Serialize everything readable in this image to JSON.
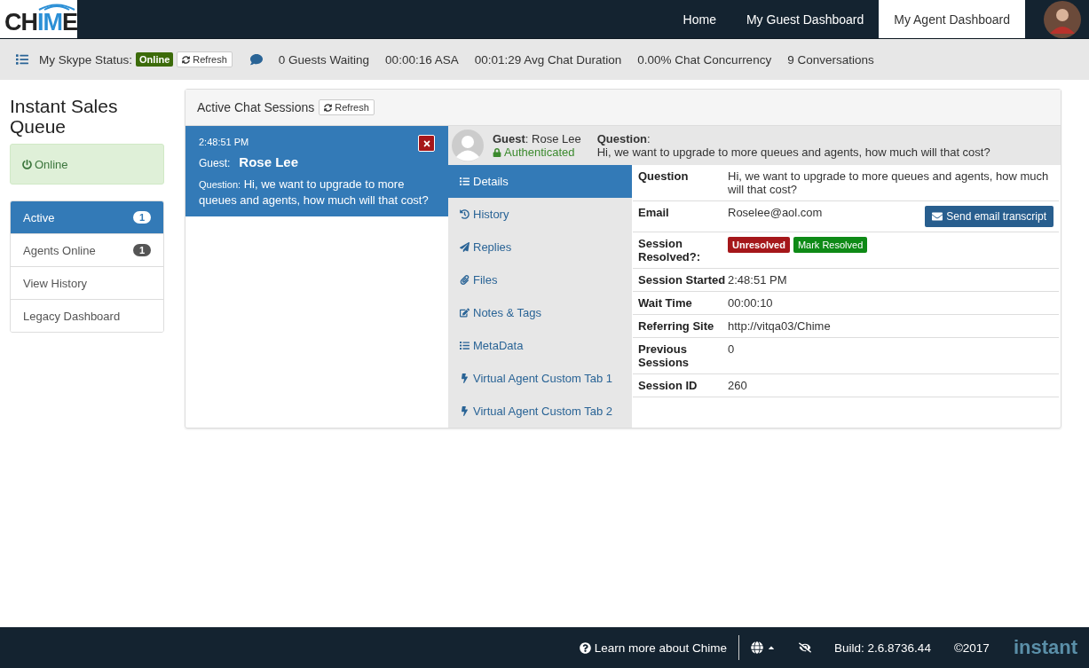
{
  "logo": {
    "parts": [
      {
        "text": "CH",
        "highlight": false
      },
      {
        "text": "IM",
        "highlight": true
      },
      {
        "text": "E",
        "highlight": false
      }
    ]
  },
  "nav": [
    {
      "label": "Home",
      "selected": false
    },
    {
      "label": "My Guest Dashboard",
      "selected": false
    },
    {
      "label": "My Agent Dashboard",
      "selected": true
    }
  ],
  "toolbar": {
    "skype_label": "My Skype Status:",
    "skype_status": "Online",
    "refresh": "Refresh",
    "stats": [
      "0 Guests Waiting",
      "00:00:16 ASA",
      "00:01:29 Avg Chat Duration",
      "0.00% Chat Concurrency",
      "9 Conversations"
    ]
  },
  "sidebar": {
    "title": "Instant Sales Queue",
    "status": "Online",
    "items": [
      {
        "label": "Active",
        "badge": "1",
        "selected": true
      },
      {
        "label": "Agents Online",
        "badge": "1",
        "selected": false
      },
      {
        "label": "View History",
        "selected": false
      },
      {
        "label": "Legacy Dashboard",
        "selected": false
      }
    ]
  },
  "panel": {
    "title": "Active Chat Sessions",
    "refresh": "Refresh",
    "sessions": [
      {
        "time": "2:48:51 PM",
        "guest_label": "Guest:",
        "guest": "Rose Lee",
        "question_label": "Question:",
        "question": "Hi, we want to upgrade to more queues and agents, how much will that cost?",
        "selected": true
      }
    ],
    "header": {
      "guest": "**Guest**: Rose Lee",
      "auth": "Authenticated",
      "question_label": "**Question**:",
      "question": "Hi, we want to upgrade to more queues and agents, how much will that cost?"
    },
    "tabs": [
      {
        "label": "Details",
        "selected": true
      },
      {
        "label": "History",
        "selected": false
      },
      {
        "label": "Replies",
        "selected": false
      },
      {
        "label": "Files",
        "selected": false
      },
      {
        "label": "Notes & Tags",
        "selected": false
      },
      {
        "label": "MetaData",
        "selected": false
      },
      {
        "label": "Virtual Agent Custom Tab 1",
        "selected": false
      },
      {
        "label": "Virtual Agent Custom Tab 2",
        "selected": false
      }
    ],
    "details": [
      {
        "kind": "text",
        "label": "Question",
        "value": "Hi, we want to upgrade to more queues and agents, how much will that cost?"
      },
      {
        "kind": "email",
        "label": "Email",
        "value": "Roselee@aol.com",
        "button": "Send email transcript"
      },
      {
        "kind": "status",
        "label": "Session Resolved?:",
        "status": "Unresolved",
        "button": "Mark Resolved"
      },
      {
        "kind": "text",
        "label": "Session Started",
        "value": "2:48:51 PM"
      },
      {
        "kind": "text",
        "label": "Wait Time",
        "value": "00:00:10"
      },
      {
        "kind": "text",
        "label": "Referring Site",
        "value": "http://vitqa03/Chime"
      },
      {
        "kind": "text",
        "label": "Previous Sessions",
        "value": "0"
      },
      {
        "kind": "text",
        "label": "Session ID",
        "value": "260"
      }
    ]
  },
  "footer": {
    "learn": "Learn more about Chime",
    "build": "Build: 2.6.8736.44",
    "copyright": "©2017",
    "brand": "instant"
  }
}
